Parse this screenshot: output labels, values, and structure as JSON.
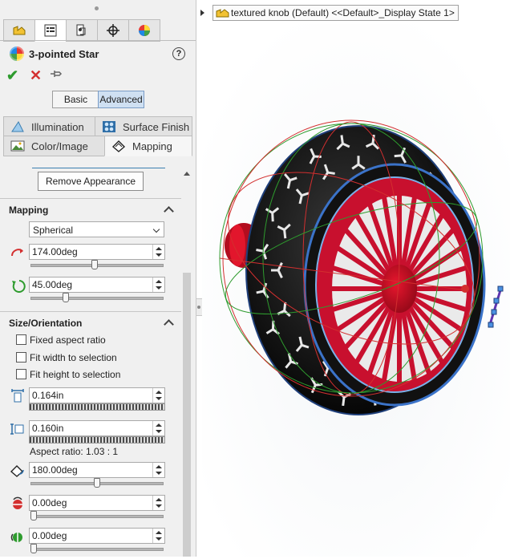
{
  "header": {
    "tree_item": "textured knob (Default) <<Default>_Display State 1>"
  },
  "panel": {
    "title": "3-pointed Star",
    "modes": {
      "basic": "Basic",
      "advanced": "Advanced",
      "active": "Advanced"
    },
    "property_tabs": [
      {
        "label": "Illumination",
        "icon": "illumination-icon"
      },
      {
        "label": "Surface Finish",
        "icon": "surface-finish-icon"
      },
      {
        "label": "Color/Image",
        "icon": "color-image-icon"
      },
      {
        "label": "Mapping",
        "icon": "mapping-icon",
        "active": true
      }
    ],
    "remove_button": "Remove Appearance",
    "mapping": {
      "heading": "Mapping",
      "type": "Spherical",
      "rotation_1": "174.00deg",
      "rotation_1_level": 0.48,
      "rotation_2": "45.00deg",
      "rotation_2_level": 0.25
    },
    "size_orientation": {
      "heading": "Size/Orientation",
      "fixed_aspect": "Fixed aspect ratio",
      "fit_width": "Fit width to selection",
      "fit_height": "Fit height to selection",
      "width": "0.164in",
      "height": "0.160in",
      "aspect_ratio": "Aspect ratio: 1.03 : 1",
      "rotation": "180.00deg",
      "rotation_level": 0.5,
      "mirror_horizontal": "0.00deg",
      "mirror_horizontal_level": 0.0,
      "mirror_vertical": "0.00deg",
      "mirror_vertical_level": 0.0
    }
  },
  "colors": {
    "accent": "#3c7fb1",
    "ok": "#2e9b2e",
    "cancel": "#d32f2f",
    "knob_red": "#c8102e"
  }
}
